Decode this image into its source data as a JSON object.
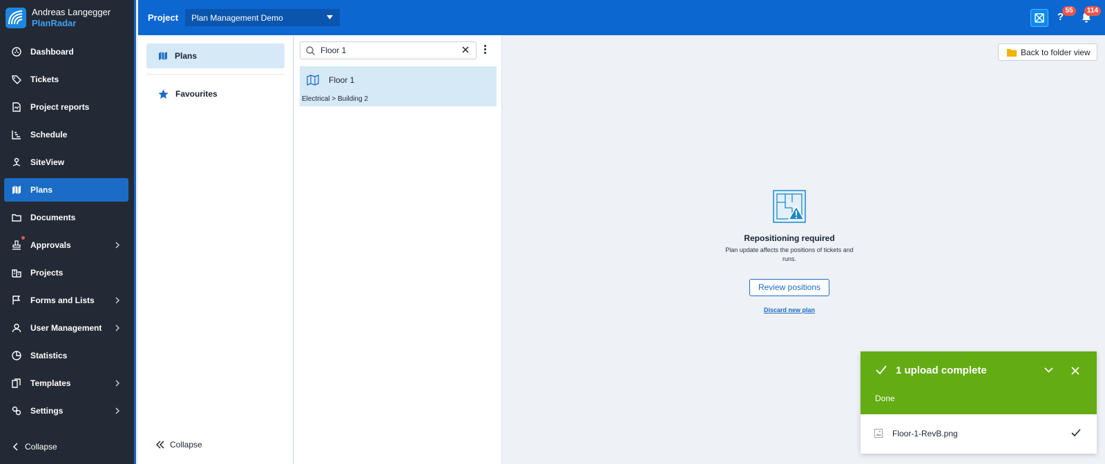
{
  "brand": {
    "user": "Andreas Langegger",
    "app": "PlanRadar"
  },
  "nav": {
    "items": [
      {
        "label": "Dashboard",
        "icon": "dashboard-icon"
      },
      {
        "label": "Tickets",
        "icon": "tag-icon"
      },
      {
        "label": "Project reports",
        "icon": "report-icon"
      },
      {
        "label": "Schedule",
        "icon": "schedule-icon"
      },
      {
        "label": "SiteView",
        "icon": "siteview-icon"
      },
      {
        "label": "Plans",
        "icon": "map-icon"
      },
      {
        "label": "Documents",
        "icon": "folder-icon"
      },
      {
        "label": "Approvals",
        "icon": "stamp-icon"
      },
      {
        "label": "Projects",
        "icon": "building-icon"
      },
      {
        "label": "Forms and Lists",
        "icon": "flag-icon"
      },
      {
        "label": "User Management",
        "icon": "user-icon"
      },
      {
        "label": "Statistics",
        "icon": "pie-icon"
      },
      {
        "label": "Templates",
        "icon": "templates-icon"
      },
      {
        "label": "Settings",
        "icon": "settings-icon"
      }
    ],
    "active": "Plans",
    "collapse_label": "Collapse"
  },
  "topbar": {
    "project_label": "Project",
    "project_value": "Plan Management Demo",
    "help_badge": "55",
    "notifications_badge": "114"
  },
  "subnav": {
    "plans_label": "Plans",
    "favourites_label": "Favourites",
    "collapse_label": "Collapse"
  },
  "list": {
    "search_value": "Floor 1",
    "plan_name": "Floor 1",
    "plan_path": "Electrical > Building 2"
  },
  "main": {
    "back_label": "Back to folder view",
    "repo_title": "Repositioning required",
    "repo_desc": "Plan update affects the positions of tickets and runs.",
    "review_label": "Review positions",
    "discard_label": "Discard new plan"
  },
  "toast": {
    "title": "1 upload complete",
    "status": "Done",
    "file_name": "Floor-1-RevB.png"
  },
  "colors": {
    "brand_blue": "#0d67d1",
    "nav_bg": "#232a35",
    "active_blue": "#1b6cc6",
    "success_green": "#63ac14",
    "badge_red": "#e9574d"
  }
}
